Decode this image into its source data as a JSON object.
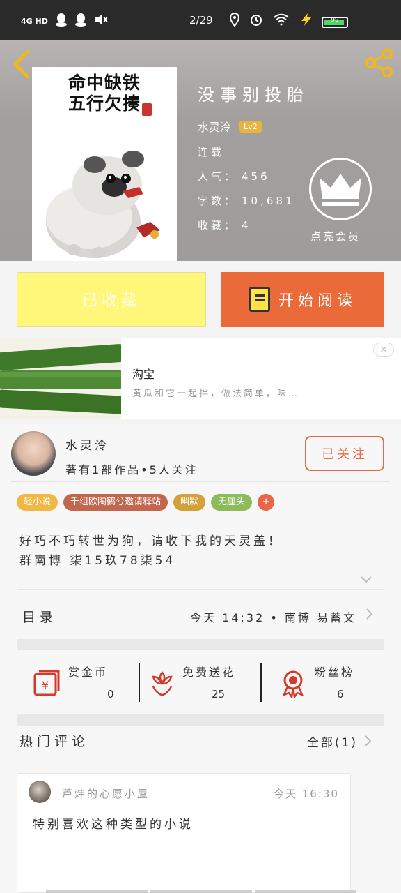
{
  "status_bar": {
    "network": "4G HD",
    "time": "2/29",
    "battery": "99"
  },
  "header": {
    "cover_title_line1": "命中缺铁",
    "cover_title_line2": "五行欠揍",
    "title": "没事别投胎",
    "author": "水灵泠",
    "author_level": "Lv2",
    "status": "连载",
    "popularity_label": "人气：",
    "popularity": "456",
    "word_count_label": "字数：",
    "word_count": "10,681",
    "favorites_label": "收藏：",
    "favorites": "4",
    "vip_label": "点亮会员"
  },
  "actions": {
    "collected_label": "已收藏",
    "read_label": "开始阅读"
  },
  "ad": {
    "title": "淘宝",
    "desc": "黄瓜和它一起拌，做法简单，味…",
    "close": "×"
  },
  "author_card": {
    "name": "水灵泠",
    "stats": "著有1部作品•5人关注",
    "follow_label": "已关注",
    "tags": [
      {
        "label": "轻小说",
        "color": "#f2b845"
      },
      {
        "label": "千组欧陶鹤兮邀请释站",
        "color": "#c2664d"
      },
      {
        "label": "幽默",
        "color": "#d4a03a"
      },
      {
        "label": "无厘头",
        "color": "#8dbb5a"
      },
      {
        "label": "+",
        "color": "#e8664a"
      }
    ],
    "intro_line1": "好巧不巧转世为狗，请收下我的天灵盖！",
    "intro_line2": "群南博 柒15玖78柒54",
    "toc_label": "目录",
    "toc_latest": "今天 14:32 • 南博 易蓄文",
    "stats_row": [
      {
        "label": "赏金币",
        "value": "0"
      },
      {
        "label": "免费送花",
        "value": "25"
      },
      {
        "label": "粉丝榜",
        "value": "6"
      }
    ],
    "comments_title": "热门评论",
    "comments_all": "全部(1)",
    "comment": {
      "user": "芦炜的心愿小屋",
      "time": "今天 16:30",
      "text": "特别喜欢这种类型的小说"
    }
  }
}
